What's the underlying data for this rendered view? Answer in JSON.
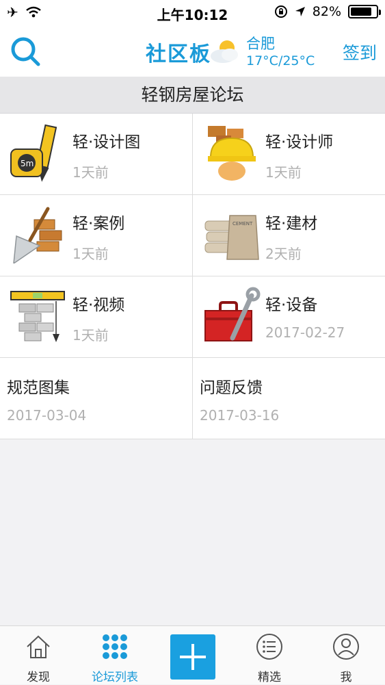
{
  "status_bar": {
    "time": "上午10:12",
    "battery": "82%",
    "battery_level": 0.82,
    "icons": [
      "airplane-icon",
      "wifi-icon",
      "orientation-lock-icon",
      "location-arrow-icon",
      "battery-icon"
    ]
  },
  "navbar": {
    "title": "社区板",
    "search_icon": "search-icon",
    "weather": {
      "icon": "partly-cloudy-icon",
      "city": "合肥",
      "temp": "17°C/25°C"
    },
    "signin_label": "签到"
  },
  "section": {
    "title": "轻钢房屋论坛"
  },
  "forums": [
    {
      "title": "轻·设计图",
      "time": "1天前",
      "icon": "design-drawing-icon"
    },
    {
      "title": "轻·设计师",
      "time": "1天前",
      "icon": "designer-helmet-icon"
    },
    {
      "title": "轻·案例",
      "time": "1天前",
      "icon": "bricks-trowel-icon"
    },
    {
      "title": "轻·建材",
      "time": "2天前",
      "icon": "cement-bags-icon"
    },
    {
      "title": "轻·视频",
      "time": "1天前",
      "icon": "wall-level-icon"
    },
    {
      "title": "轻·设备",
      "time": "2017-02-27",
      "icon": "toolbox-wrench-icon"
    },
    {
      "title": "规范图集",
      "time": "2017-03-04"
    },
    {
      "title": "问题反馈",
      "time": "2017-03-16"
    }
  ],
  "tabbar": {
    "tabs": [
      {
        "label": "发现",
        "icon": "home-icon"
      },
      {
        "label": "论坛列表",
        "icon": "grid-dots-icon",
        "active": true
      },
      {
        "label": "",
        "icon": "plus-icon"
      },
      {
        "label": "精选",
        "icon": "list-circle-icon"
      },
      {
        "label": "我",
        "icon": "user-circle-icon"
      }
    ]
  },
  "colors": {
    "accent": "#1a9ad8",
    "muted_text": "#b0b0b0",
    "header_bg": "#e6e6e8"
  }
}
